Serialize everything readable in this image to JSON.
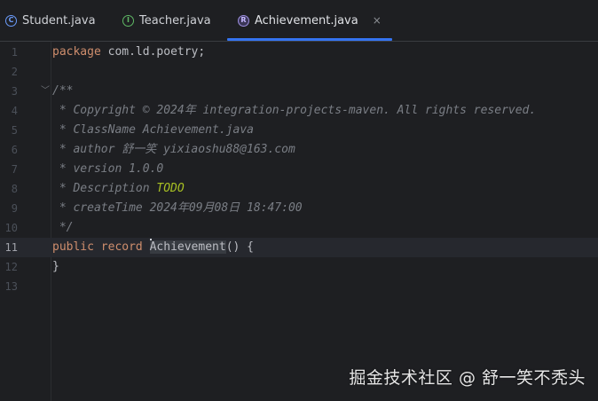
{
  "tabs": [
    {
      "label": "Student.java",
      "icon": "class-icon",
      "icon_glyph": "C"
    },
    {
      "label": "Teacher.java",
      "icon": "interface-icon",
      "icon_glyph": "I"
    },
    {
      "label": "Achievement.java",
      "icon": "record-icon",
      "icon_glyph": "R",
      "active": true,
      "close": "×"
    }
  ],
  "editor": {
    "current_line": 11,
    "lines": [
      {
        "n": "1",
        "text": "package com.ld.poetry;"
      },
      {
        "n": "2",
        "text": ""
      },
      {
        "n": "3",
        "text": "/**"
      },
      {
        "n": "4",
        "text": " * Copyright © 2024年 integration-projects-maven. All rights reserved."
      },
      {
        "n": "5",
        "text": " * ClassName Achievement.java"
      },
      {
        "n": "6",
        "text": " * author 舒一笑 yixiaoshu88@163.com"
      },
      {
        "n": "7",
        "text": " * version 1.0.0"
      },
      {
        "n": "8",
        "text": " * Description TODO"
      },
      {
        "n": "9",
        "text": " * createTime 2024年09月08日 18:47:00"
      },
      {
        "n": "10",
        "text": " */"
      },
      {
        "n": "11",
        "text": "public record Achievement() {"
      },
      {
        "n": "12",
        "text": "}"
      },
      {
        "n": "13",
        "text": ""
      }
    ],
    "tokens": {
      "package_kw": "package",
      "package_name": " com.ld.poetry;",
      "public_kw": "public",
      "record_kw": "record",
      "class_name": "Achievement",
      "record_tail": "() {",
      "doc_open": "/**",
      "copyright": " * Copyright © 2024年 integration-projects-maven. All rights reserved.",
      "classname": " * ClassName Achievement.java",
      "author": " * author 舒一笑 yixiaoshu88@163.com",
      "version": " * version 1.0.0",
      "description": " * Description ",
      "todo": "TODO",
      "createtime": " * createTime 2024年09月08日 18:47:00",
      "doc_close": " */",
      "brace_close": "}"
    }
  },
  "watermark": "掘金技术社区 @ 舒一笑不秃头",
  "colors": {
    "background": "#1e1f22",
    "keyword": "#cf8e6d",
    "comment": "#7a7e85",
    "todo": "#a8c023",
    "accent": "#3574f0"
  }
}
